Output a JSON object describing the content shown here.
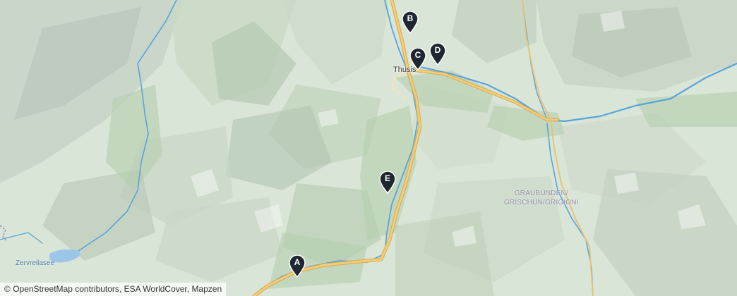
{
  "map": {
    "place_labels": {
      "town": "Thusis",
      "lake": "Zervreilasee",
      "region_line1": "GRAUBÜNDEN/",
      "region_line2": "GRISCHUN/GRIGIONI"
    },
    "markers": [
      {
        "label": "A"
      },
      {
        "label": "B"
      },
      {
        "label": "C"
      },
      {
        "label": "D"
      },
      {
        "label": "E"
      }
    ],
    "attribution": {
      "copyright": "©",
      "osm": "OpenStreetMap contributors",
      "esa": "ESA WorldCover",
      "mapzen": "Mapzen",
      "separator": ", "
    },
    "colors": {
      "forest": "#c3d8bf",
      "meadow": "#e2ece0",
      "rock": "#c9cfc9",
      "water": "#5ba3d9",
      "road_major": "#f2cd7a",
      "road_casing": "#d9a94e",
      "marker": "#1f2730"
    }
  }
}
